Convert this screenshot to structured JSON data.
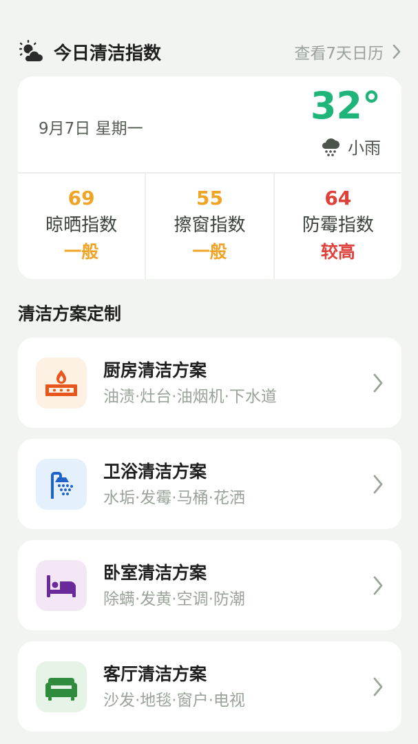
{
  "header": {
    "title": "今日清洁指数",
    "calendar_link": "查看7天日历"
  },
  "weather": {
    "date": "9月7日 星期一",
    "temperature": "32°",
    "condition": "小雨"
  },
  "indices": [
    {
      "value": "69",
      "name": "晾晒指数",
      "level": "一般",
      "color": "#f0a425"
    },
    {
      "value": "55",
      "name": "擦窗指数",
      "level": "一般",
      "color": "#f0a425"
    },
    {
      "value": "64",
      "name": "防霉指数",
      "level": "较高",
      "color": "#e0403a"
    }
  ],
  "plans_section": {
    "title": "清洁方案定制",
    "items": [
      {
        "title": "厨房清洁方案",
        "tags": "油渍·灶台·油烟机·下水道",
        "icon": "stove-icon",
        "icon_color": "#e8561e",
        "icon_bg": "#fdf1e3"
      },
      {
        "title": "卫浴清洁方案",
        "tags": "水垢·发霉·马桶·花洒",
        "icon": "shower-icon",
        "icon_color": "#1f63c9",
        "icon_bg": "#e5f0fd"
      },
      {
        "title": "卧室清洁方案",
        "tags": "除螨·发黄·空调·防潮",
        "icon": "bed-icon",
        "icon_color": "#6a2a9c",
        "icon_bg": "#f3e6f5"
      },
      {
        "title": "客厅清洁方案",
        "tags": "沙发·地毯·窗户·电视",
        "icon": "sofa-icon",
        "icon_color": "#2e8c3c",
        "icon_bg": "#e5f4e6"
      }
    ]
  },
  "colors": {
    "accent_green": "#1eb47a",
    "muted_text": "#9aa39a",
    "background": "#f2f4f1"
  }
}
